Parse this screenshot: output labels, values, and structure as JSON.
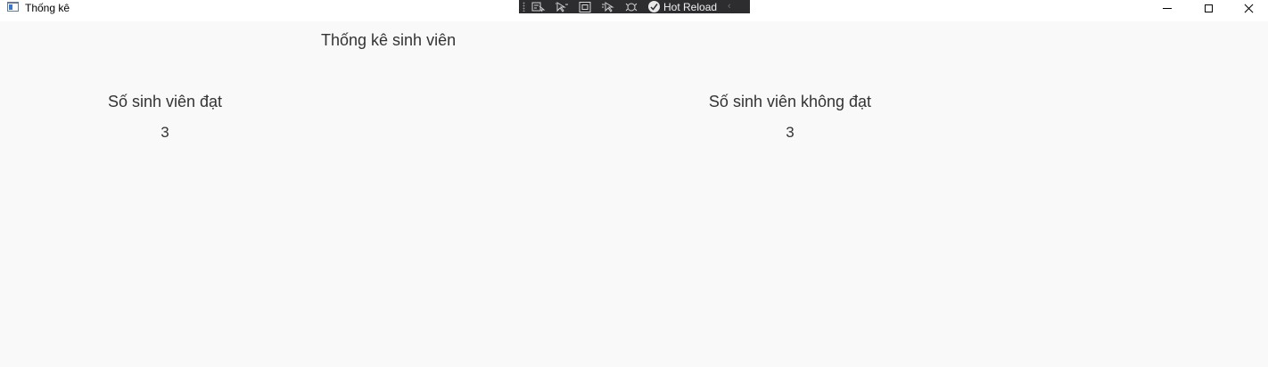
{
  "window": {
    "title": "Thống kê"
  },
  "debug_toolbar": {
    "hot_reload_label": "Hot Reload",
    "icons": [
      "select-element-icon",
      "live-preview-icon",
      "display-layout-adorners-icon",
      "track-focused-element-icon",
      "binding-failures-icon"
    ]
  },
  "page": {
    "heading": "Thống kê sinh viên",
    "stats": {
      "pass": {
        "label": "Số sinh viên đạt",
        "value": "3"
      },
      "fail": {
        "label": "Số sinh viên không đạt",
        "value": "3"
      }
    }
  },
  "colors": {
    "background": "#f9f9f9",
    "toolbar": "#2d2d30",
    "text": "#333333"
  }
}
